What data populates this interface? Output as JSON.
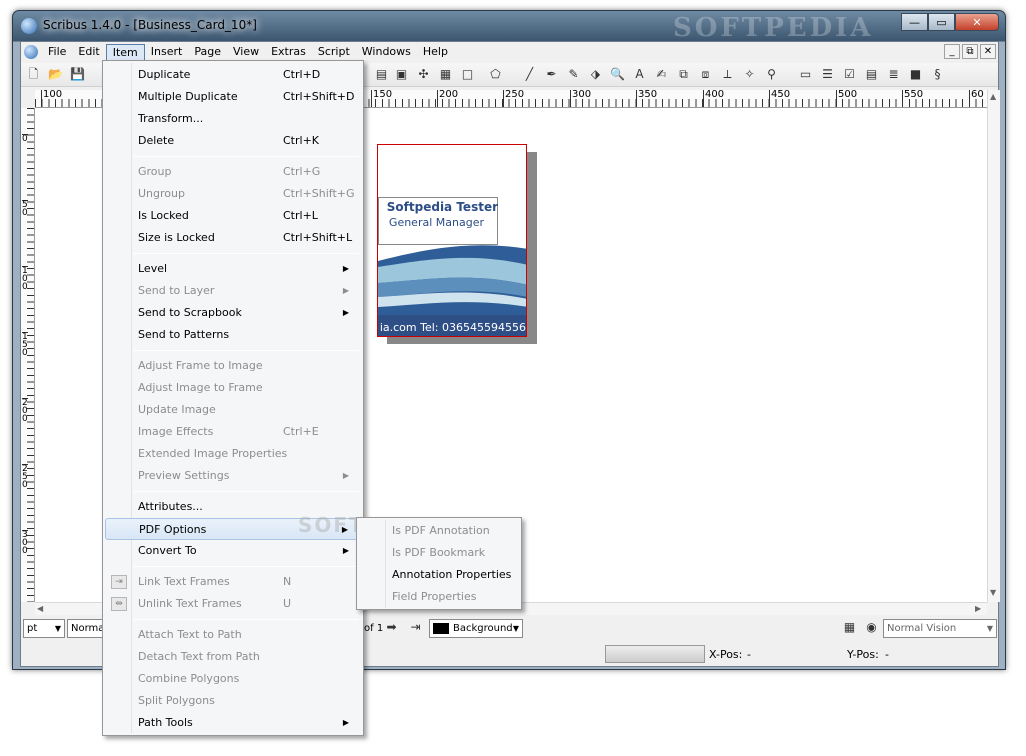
{
  "window": {
    "title": "Scribus 1.4.0 - [Business_Card_10*]",
    "watermark": "SOFTPEDIA",
    "minimize": "—",
    "maximize": "▭",
    "close": "✕"
  },
  "menubar": {
    "items": [
      "File",
      "Edit",
      "Item",
      "Insert",
      "Page",
      "View",
      "Extras",
      "Script",
      "Windows",
      "Help"
    ],
    "active": "Item",
    "mdi_buttons": [
      "_",
      "⧉",
      "✕"
    ]
  },
  "ruler": {
    "h_labels": [
      "100",
      "150",
      "200",
      "250",
      "300",
      "350",
      "400",
      "450",
      "500",
      "550",
      "60"
    ],
    "v_labels": [
      "0",
      "5\n0",
      "1\n0\n0",
      "1\n5\n0",
      "2\n0\n0",
      "2\n5\n0",
      "3\n0\n0"
    ]
  },
  "card": {
    "name": "Softpedia Tester",
    "job": "General Manager",
    "contact": "ia.com Tel: 036545594556"
  },
  "statusbar": {
    "unit": "pt",
    "mode": "Normal",
    "page_of": "of 1",
    "layer": "Background",
    "vision": "Normal Vision",
    "xpos_label": "X-Pos:",
    "xpos_value": "-",
    "ypos_label": "Y-Pos:",
    "ypos_value": "-"
  },
  "item_menu": {
    "entries": [
      {
        "label": "Duplicate",
        "shortcut": "Ctrl+D",
        "enabled": true
      },
      {
        "label": "Multiple Duplicate",
        "shortcut": "Ctrl+Shift+D",
        "enabled": true
      },
      {
        "label": "Transform...",
        "shortcut": "",
        "enabled": true
      },
      {
        "label": "Delete",
        "shortcut": "Ctrl+K",
        "enabled": true
      },
      {
        "label": "Group",
        "shortcut": "Ctrl+G",
        "enabled": false
      },
      {
        "label": "Ungroup",
        "shortcut": "Ctrl+Shift+G",
        "enabled": false
      },
      {
        "label": "Is Locked",
        "shortcut": "Ctrl+L",
        "enabled": true
      },
      {
        "label": "Size is Locked",
        "shortcut": "Ctrl+Shift+L",
        "enabled": true
      },
      {
        "label": "Level",
        "shortcut": "",
        "enabled": true,
        "submenu": true
      },
      {
        "label": "Send to Layer",
        "shortcut": "",
        "enabled": false,
        "submenu": true
      },
      {
        "label": "Send to Scrapbook",
        "shortcut": "",
        "enabled": true,
        "submenu": true
      },
      {
        "label": "Send to Patterns",
        "shortcut": "",
        "enabled": true
      },
      {
        "label": "Adjust Frame to Image",
        "shortcut": "",
        "enabled": false
      },
      {
        "label": "Adjust Image to Frame",
        "shortcut": "",
        "enabled": false
      },
      {
        "label": "Update Image",
        "shortcut": "",
        "enabled": false
      },
      {
        "label": "Image Effects",
        "shortcut": "Ctrl+E",
        "enabled": false
      },
      {
        "label": "Extended Image Properties",
        "shortcut": "",
        "enabled": false
      },
      {
        "label": "Preview Settings",
        "shortcut": "",
        "enabled": false,
        "submenu": true
      },
      {
        "label": "Attributes...",
        "shortcut": "",
        "enabled": true
      },
      {
        "label": "PDF Options",
        "shortcut": "",
        "enabled": true,
        "submenu": true,
        "highlighted": true
      },
      {
        "label": "Convert To",
        "shortcut": "",
        "enabled": true,
        "submenu": true
      },
      {
        "label": "Link Text Frames",
        "shortcut": "N",
        "enabled": false,
        "icon": "link-frames-icon"
      },
      {
        "label": "Unlink Text Frames",
        "shortcut": "U",
        "enabled": false,
        "icon": "unlink-frames-icon"
      },
      {
        "label": "Attach Text to Path",
        "shortcut": "",
        "enabled": false
      },
      {
        "label": "Detach Text from Path",
        "shortcut": "",
        "enabled": false
      },
      {
        "label": "Combine Polygons",
        "shortcut": "",
        "enabled": false
      },
      {
        "label": "Split Polygons",
        "shortcut": "",
        "enabled": false
      },
      {
        "label": "Path Tools",
        "shortcut": "",
        "enabled": true,
        "submenu": true
      }
    ]
  },
  "pdf_submenu": {
    "entries": [
      {
        "label": "Is PDF Annotation",
        "enabled": false
      },
      {
        "label": "Is PDF Bookmark",
        "enabled": false
      },
      {
        "label": "Annotation Properties",
        "enabled": true
      },
      {
        "label": "Field Properties",
        "enabled": false
      }
    ]
  },
  "colors": {
    "card_text": "#2c4d86",
    "wave_dark": "#2e5d97",
    "wave_light": "#9cc6dc"
  }
}
